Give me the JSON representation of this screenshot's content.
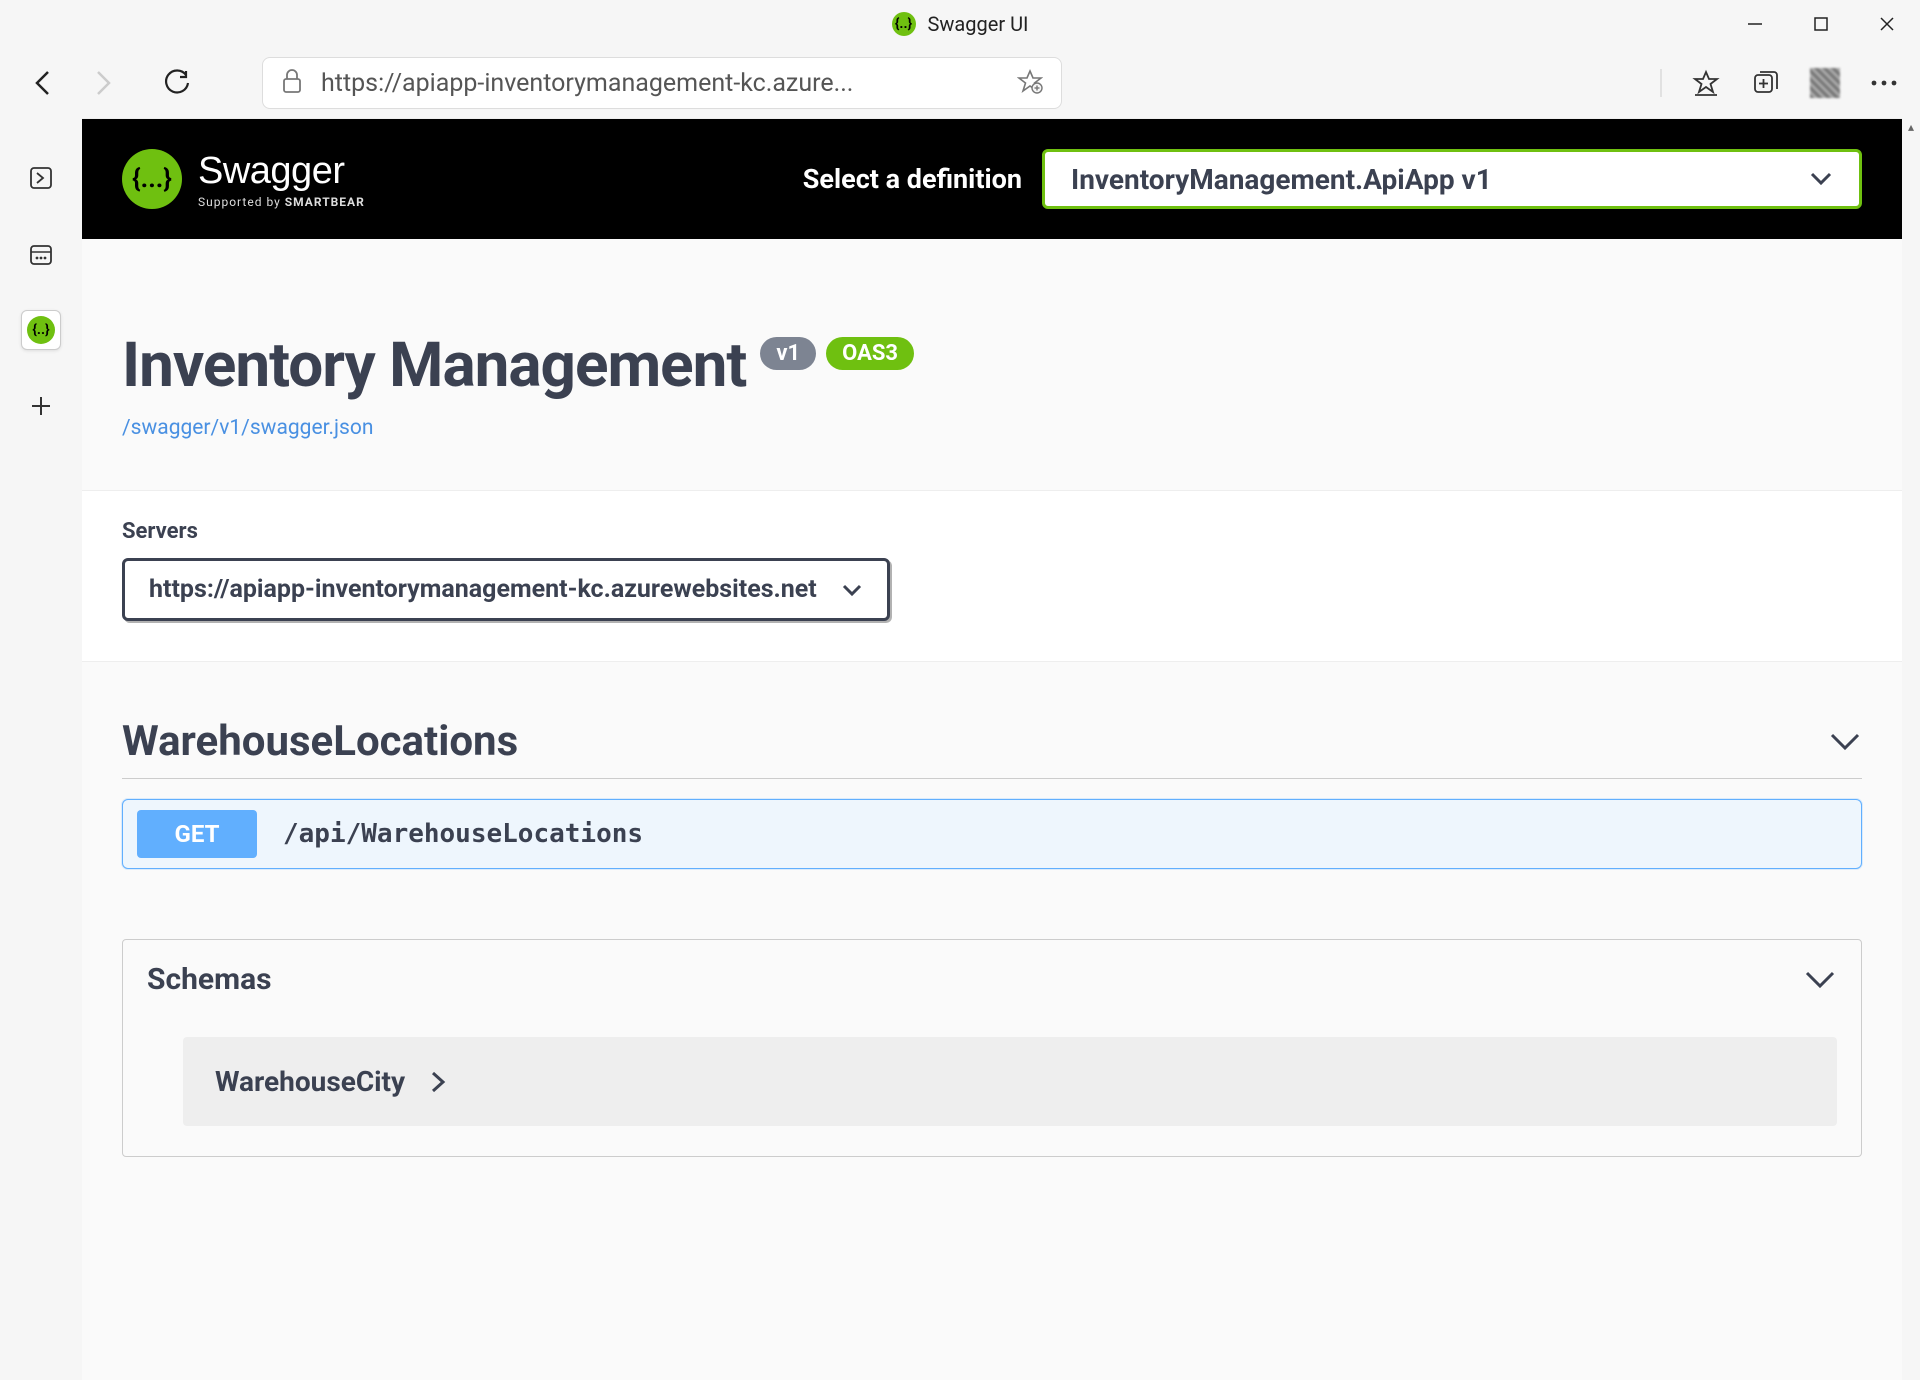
{
  "window": {
    "title": "Swagger UI"
  },
  "browser": {
    "url": "https://apiapp-inventorymanagement-kc.azure..."
  },
  "swagger": {
    "brand_name": "Swagger",
    "brand_sub_prefix": "Supported by",
    "brand_sub_bold": "SMARTBEAR",
    "select_label": "Select a definition",
    "selected_definition": "InventoryManagement.ApiApp v1"
  },
  "info": {
    "title": "Inventory Management",
    "version_badge": "v1",
    "oas_badge": "OAS3",
    "swagger_json_link": "/swagger/v1/swagger.json"
  },
  "servers": {
    "label": "Servers",
    "selected": "https://apiapp-inventorymanagement-kc.azurewebsites.net"
  },
  "tag": {
    "name": "WarehouseLocations",
    "op_method": "GET",
    "op_path": "/api/WarehouseLocations"
  },
  "schemas": {
    "title": "Schemas",
    "item0": "WarehouseCity"
  }
}
